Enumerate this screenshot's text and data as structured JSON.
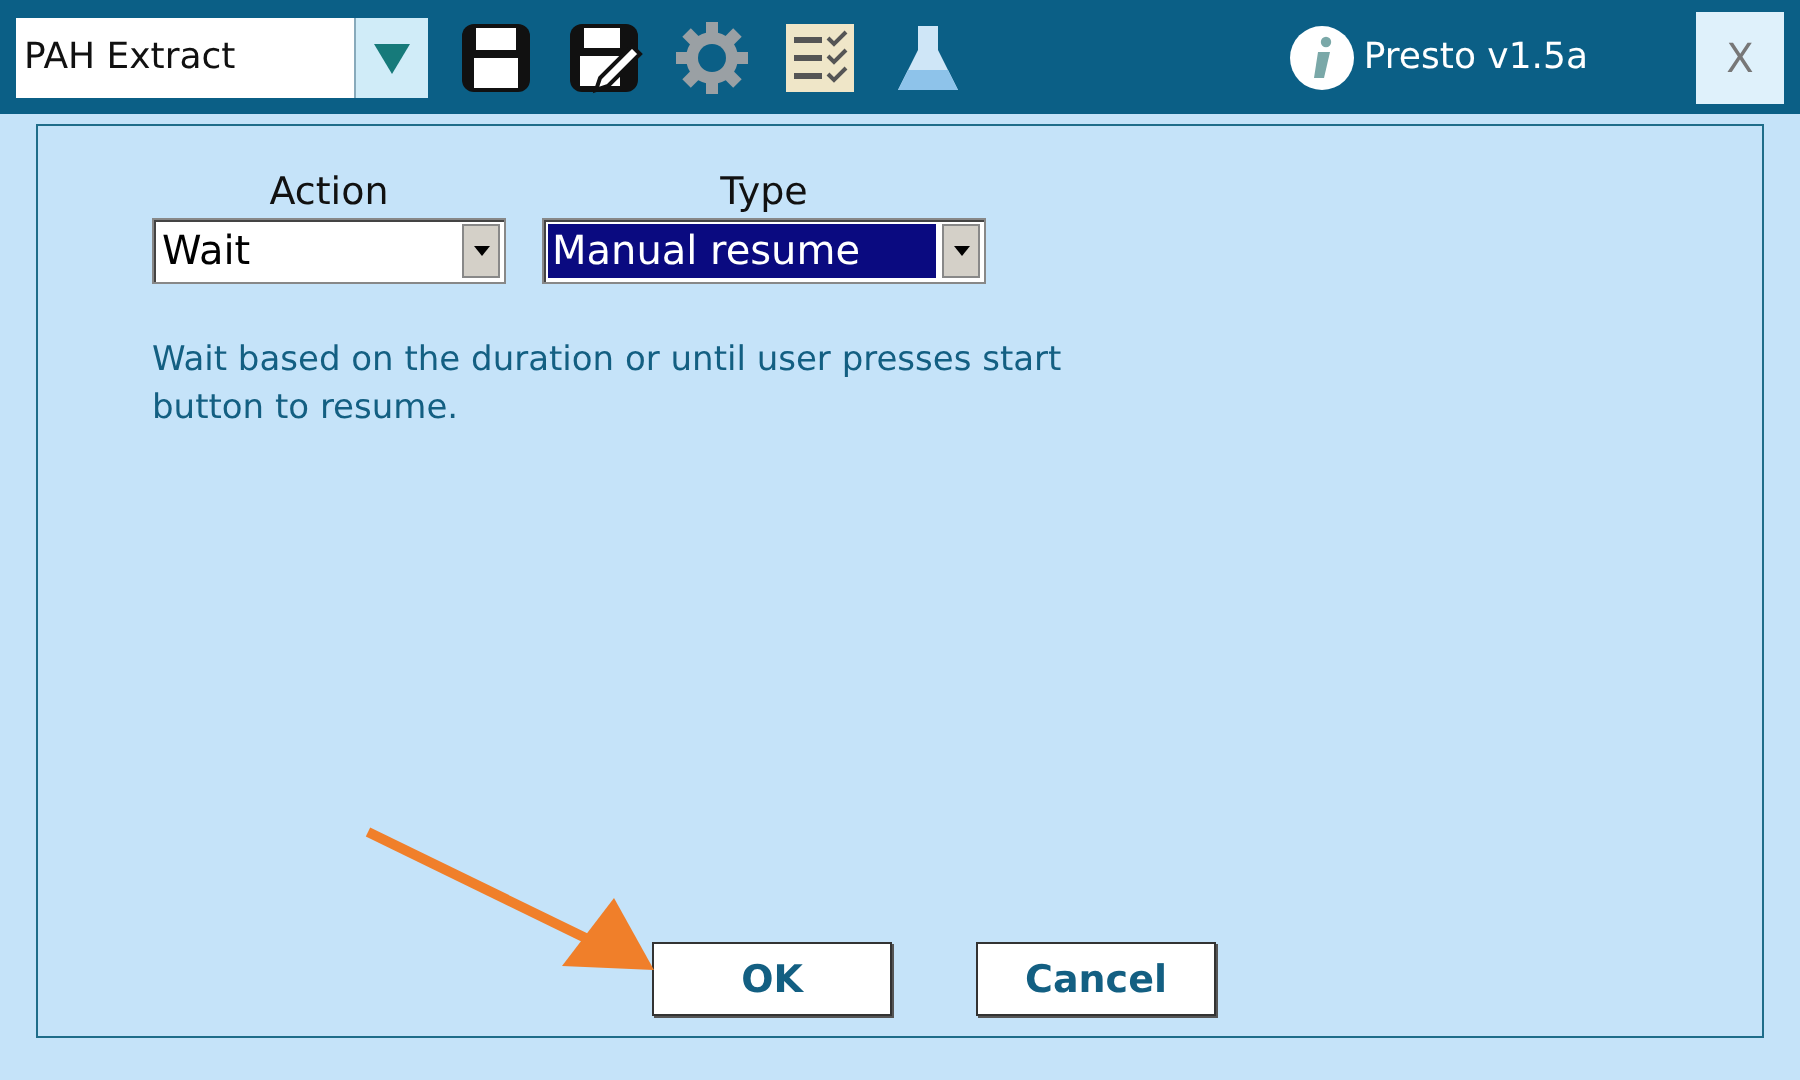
{
  "toolbar": {
    "method": "PAH Extract",
    "version": "Presto v1.5a",
    "close": "X"
  },
  "fields": [
    {
      "label": "Action",
      "value": "Wait",
      "highlighted": false
    },
    {
      "label": "Type",
      "value": "Manual resume",
      "highlighted": true
    }
  ],
  "description": "Wait based on the duration or until user presses start button to resume.",
  "buttons": [
    "OK",
    "Cancel"
  ]
}
